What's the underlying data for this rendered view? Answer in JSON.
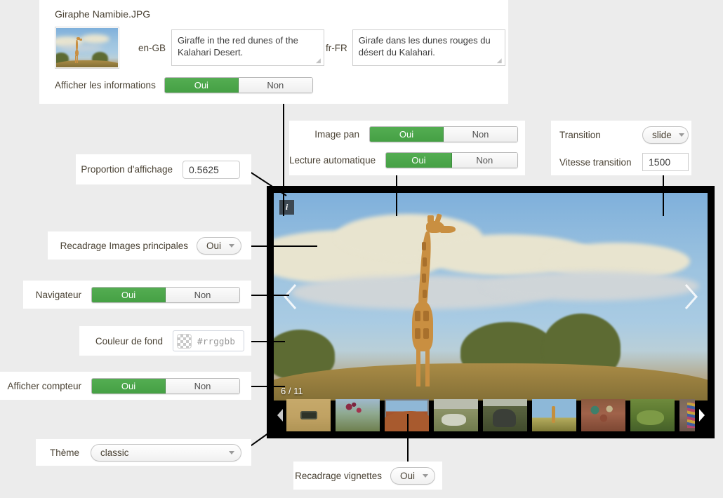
{
  "file": {
    "name": "Giraphe Namibie.JPG"
  },
  "locales": {
    "en_label": "en-GB",
    "en_value": "Giraffe in the red dunes of the Kalahari Desert.",
    "fr_label": "fr-FR",
    "fr_value": "Girafe dans les dunes rouges du désert du Kalahari."
  },
  "toggle": {
    "yes": "Oui",
    "no": "Non"
  },
  "options": {
    "show_info": {
      "label": "Afficher les informations",
      "value": "Oui"
    },
    "image_pan": {
      "label": "Image pan",
      "value": "Oui"
    },
    "autoplay": {
      "label": "Lecture automatique",
      "value": "Oui"
    },
    "transition": {
      "label": "Transition",
      "value": "slide"
    },
    "transition_speed": {
      "label": "Vitesse transition",
      "value": "1500"
    },
    "display_ratio": {
      "label": "Proportion d'affichage",
      "value": "0.5625"
    },
    "crop_main": {
      "label": "Recadrage Images principales",
      "value": "Oui"
    },
    "navigator": {
      "label": "Navigateur",
      "value": "Oui"
    },
    "background_color": {
      "label": "Couleur de fond",
      "value": "",
      "placeholder": "#rrggbb"
    },
    "show_counter": {
      "label": "Afficher compteur",
      "value": "Oui"
    },
    "theme": {
      "label": "Thème",
      "value": "classic"
    },
    "crop_thumbs": {
      "label": "Recadrage vignettes",
      "value": "Oui"
    }
  },
  "slideshow": {
    "counter": "6 / 11",
    "info_icon": "info-icon",
    "prev_icon": "chevron-left-icon",
    "next_icon": "chevron-right-icon",
    "strip_prev_icon": "triangle-left-icon",
    "strip_next_icon": "triangle-right-icon",
    "thumbnails": [
      {
        "name": "thumbnail-jeep",
        "cls": "t-jeep"
      },
      {
        "name": "thumbnail-flowers",
        "cls": "t-flower"
      },
      {
        "name": "thumbnail-dune",
        "cls": "t-dune"
      },
      {
        "name": "thumbnail-rocks",
        "cls": "t-rock"
      },
      {
        "name": "thumbnail-elephant",
        "cls": "t-eleph"
      },
      {
        "name": "thumbnail-giraffe",
        "cls": "t-gir2"
      },
      {
        "name": "thumbnail-market",
        "cls": "t-mkt"
      },
      {
        "name": "thumbnail-greenery",
        "cls": "t-green"
      },
      {
        "name": "thumbnail-fabrics",
        "cls": "t-fab"
      }
    ],
    "selected_index": 2
  },
  "colors": {
    "accent_green": "#4ca64c",
    "page_background": "#ececec",
    "panel_background": "#ffffff",
    "frame_black": "#000000",
    "info_badge": "#3d4852",
    "label_text": "#4a4234"
  }
}
